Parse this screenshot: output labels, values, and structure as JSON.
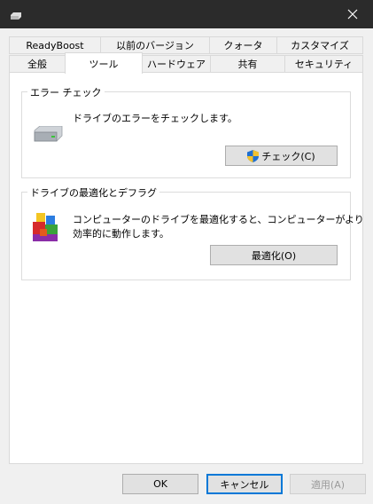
{
  "tabs_row1": [
    {
      "label": "ReadyBoost"
    },
    {
      "label": "以前のバージョン"
    },
    {
      "label": "クォータ"
    },
    {
      "label": "カスタマイズ"
    }
  ],
  "tabs_row2": [
    {
      "label": "全般"
    },
    {
      "label": "ツール",
      "selected": true
    },
    {
      "label": "ハードウェア"
    },
    {
      "label": "共有"
    },
    {
      "label": "セキュリティ"
    }
  ],
  "error_check": {
    "title": "エラー チェック",
    "description": "ドライブのエラーをチェックします。",
    "button_label": "チェック(C)"
  },
  "optimize": {
    "title": "ドライブの最適化とデフラグ",
    "description_line1": "コンピューターのドライブを最適化すると、コンピューターがより",
    "description_line2": "効率的に動作します。",
    "button_label": "最適化(O)"
  },
  "footer": {
    "ok_label": "OK",
    "cancel_label": "キャンセル",
    "apply_label": "適用(A)"
  },
  "colors": {
    "titlebar": "#2b2b2b",
    "accent": "#0078d7"
  }
}
